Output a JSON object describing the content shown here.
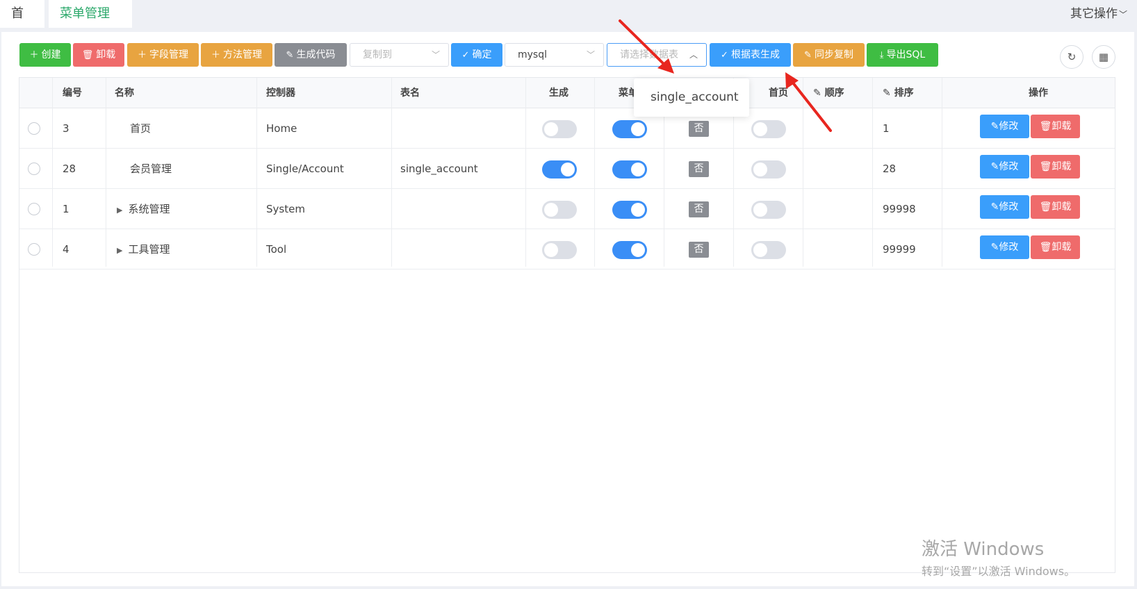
{
  "tabs": {
    "home": "首页",
    "menu": "菜单管理",
    "close": "×",
    "other_ops": "其它操作"
  },
  "toolbar": {
    "create": "创建",
    "uninstall": "卸载",
    "field_mgmt": "字段管理",
    "method_mgmt": "方法管理",
    "gen_code": "生成代码",
    "copy_to_placeholder": "复制到",
    "confirm": "确定",
    "db_value": "mysql",
    "table_placeholder": "请选择数据表",
    "gen_by_table": "根据表生成",
    "sync_copy": "同步复制",
    "export_sql": "导出SQL"
  },
  "columns": [
    "编号",
    "名称",
    "控制器",
    "表名",
    "生成",
    "菜单",
    "",
    "首页",
    "顺序",
    "排序",
    "操作"
  ],
  "rows": [
    {
      "id": "3",
      "name": "首页",
      "controller": "Home",
      "table": "",
      "gen": false,
      "menu": true,
      "badge": "否",
      "home": false,
      "sort": "1",
      "expandable": false
    },
    {
      "id": "28",
      "name": "会员管理",
      "controller": "Single/Account",
      "table": "single_account",
      "gen": true,
      "menu": true,
      "badge": "否",
      "home": false,
      "sort": "28",
      "expandable": false
    },
    {
      "id": "1",
      "name": "系统管理",
      "controller": "System",
      "table": "",
      "gen": false,
      "menu": true,
      "badge": "否",
      "home": false,
      "sort": "99998",
      "expandable": true
    },
    {
      "id": "4",
      "name": "工具管理",
      "controller": "Tool",
      "table": "",
      "gen": false,
      "menu": true,
      "badge": "否",
      "home": false,
      "sort": "99999",
      "expandable": true
    }
  ],
  "row_actions": {
    "edit": "修改",
    "uninstall": "卸载"
  },
  "dropdown": {
    "option": "single_account"
  },
  "watermark": {
    "line1": "激活 Windows",
    "line2": "转到“设置”以激活 Windows。"
  },
  "colors": {
    "green": "#3fbd43",
    "red": "#ef6b6b",
    "orange": "#e8a440",
    "blue": "#3a9efb",
    "gray": "#8a8d93",
    "annotation": "#e8261f"
  }
}
